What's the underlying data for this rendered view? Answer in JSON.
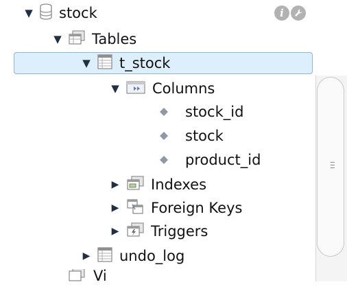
{
  "tree": {
    "schema_label": "stock",
    "tables_label": "Tables",
    "table_label": "t_stock",
    "columns_label": "Columns",
    "columns": [
      "stock_id",
      "stock",
      "product_id"
    ],
    "indexes_label": "Indexes",
    "foreign_keys_label": "Foreign Keys",
    "triggers_label": "Triggers",
    "undo_table_label": "undo_log",
    "views_label_partial": "Vi"
  },
  "icons": {
    "info": "i",
    "expanded": "▼",
    "collapsed": "▶"
  },
  "colors": {
    "selection_bg": "#ddeefc",
    "selection_border": "#8db6e1"
  }
}
